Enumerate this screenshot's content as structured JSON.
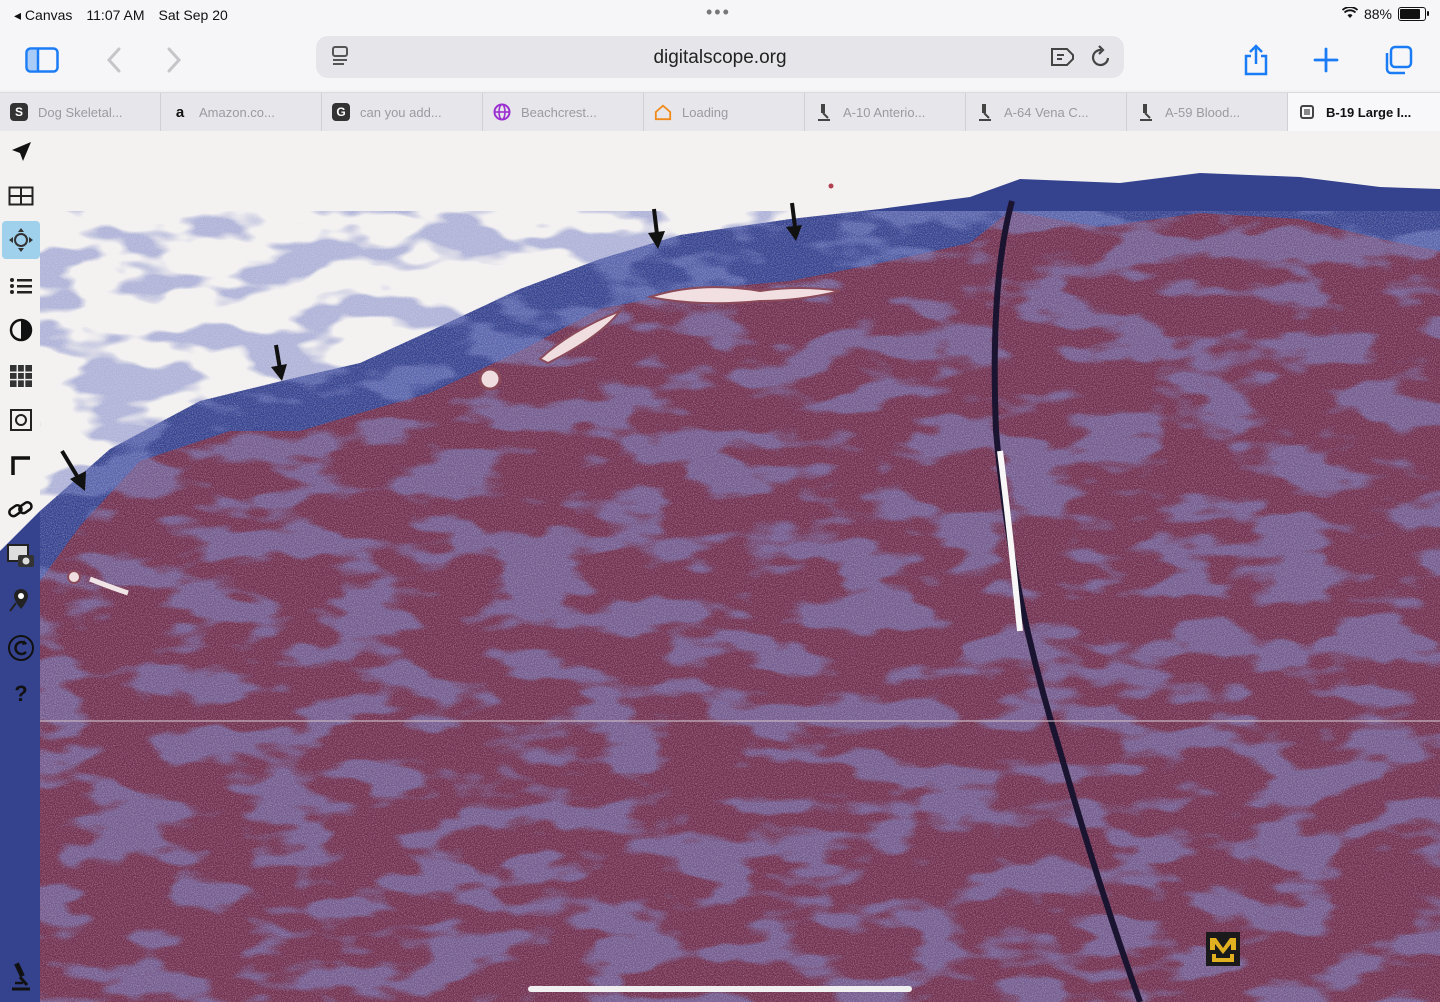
{
  "status": {
    "back_app": "◂ Canvas",
    "time": "11:07 AM",
    "date": "Sat Sep 20",
    "battery": "88%"
  },
  "toolbar": {
    "url": "digitalscope.org"
  },
  "tabs": [
    {
      "favicon": "S",
      "label": "Dog Skeletal..."
    },
    {
      "favicon": "a",
      "label": "Amazon.co..."
    },
    {
      "favicon": "G",
      "label": "can you add..."
    },
    {
      "favicon": "globe",
      "label": "Beachcrest..."
    },
    {
      "favicon": "house",
      "label": "Loading"
    },
    {
      "favicon": "microscope",
      "label": "A-10 Anterio..."
    },
    {
      "favicon": "microscope",
      "label": "A-64 Vena C..."
    },
    {
      "favicon": "microscope",
      "label": "A-59 Blood..."
    },
    {
      "favicon": "square",
      "label": "B-19 Large I..."
    }
  ],
  "sidebar_tools": [
    "navigate-arrow-icon",
    "layout-icon",
    "pan-icon",
    "list-icon",
    "contrast-icon",
    "grid-icon",
    "focus-icon",
    "ruler-icon",
    "link-icon",
    "camera-icon",
    "location-pin-icon",
    "rotate-icon",
    "help-icon",
    "microscope-icon"
  ],
  "colors": {
    "accent": "#1a7cf5",
    "tissue": "#6e2e4c",
    "connective": "#2f3f8f"
  }
}
